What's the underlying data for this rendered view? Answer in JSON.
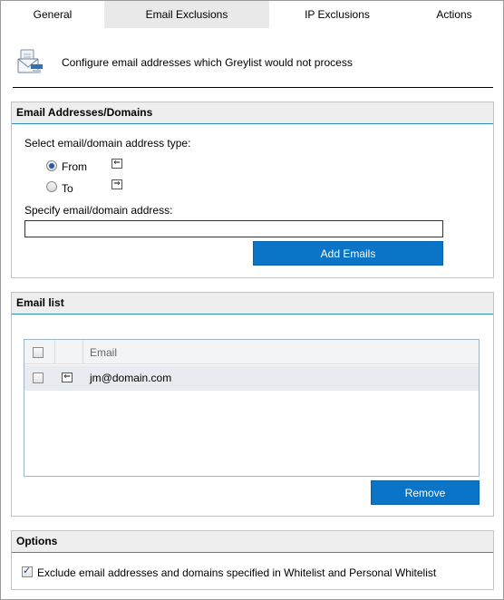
{
  "tabs": [
    {
      "label": "General"
    },
    {
      "label": "Email Exclusions"
    },
    {
      "label": "IP Exclusions"
    },
    {
      "label": "Actions"
    }
  ],
  "active_tab": "Email Exclusions",
  "header": {
    "description": "Configure email addresses which Greylist would not process",
    "icon": "email-exclusion-icon"
  },
  "address_panel": {
    "title": "Email Addresses/Domains",
    "type_label": "Select email/domain address type:",
    "options": [
      {
        "label": "From",
        "selected": true,
        "icon": "arrow-left-icon"
      },
      {
        "label": "To",
        "selected": false,
        "icon": "arrow-right-icon"
      }
    ],
    "address_label": "Specify email/domain address:",
    "address_value": "",
    "add_button": "Add Emails"
  },
  "list_panel": {
    "title": "Email list",
    "column_header": "Email",
    "rows": [
      {
        "email": "jm@domain.com",
        "direction_icon": "arrow-left-icon",
        "checked": false
      }
    ],
    "remove_button": "Remove"
  },
  "options_panel": {
    "title": "Options",
    "exclude_label": "Exclude email addresses and domains specified in Whitelist and Personal Whitelist",
    "exclude_checked": true
  },
  "colors": {
    "accent_button": "#0a74c7",
    "panel_underline": "#2c8fbf",
    "active_tab_bg": "#e9e9e9"
  }
}
